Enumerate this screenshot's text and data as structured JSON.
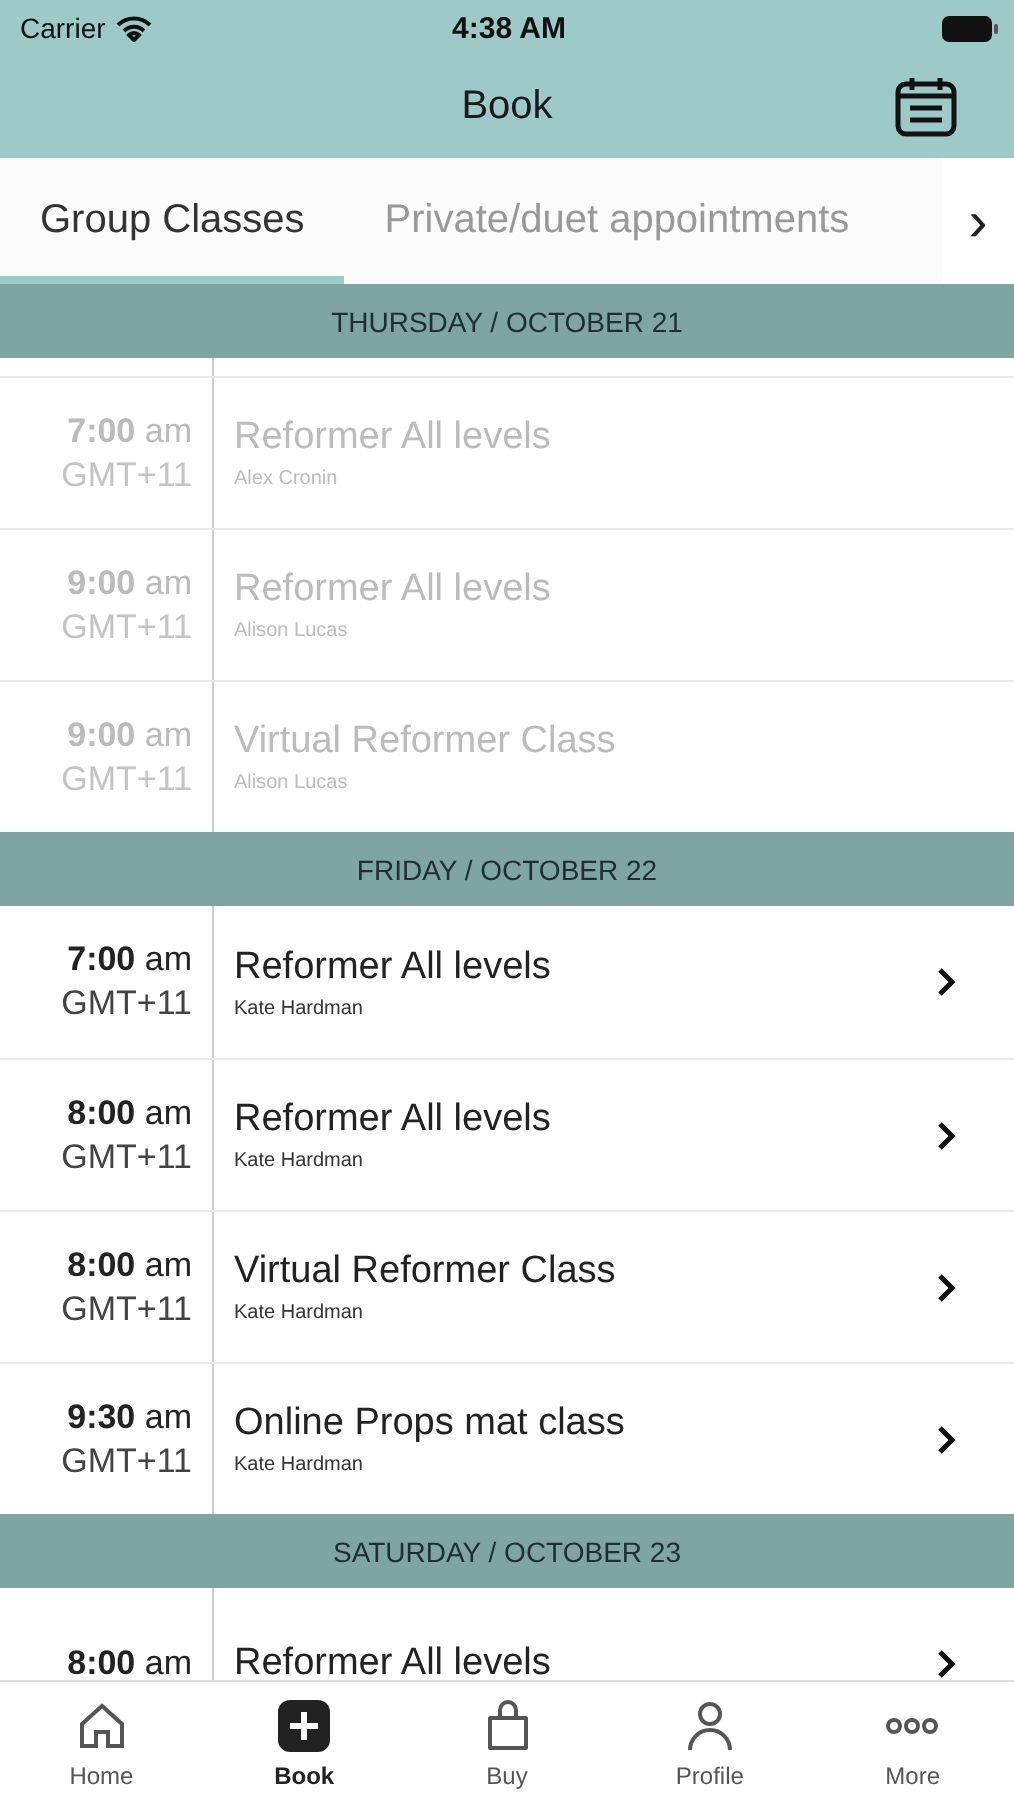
{
  "status_bar": {
    "carrier": "Carrier",
    "time": "4:38 AM"
  },
  "nav": {
    "title": "Book"
  },
  "tabs": [
    {
      "label": "Group Classes",
      "selected": true
    },
    {
      "label": "Private/duet appointments",
      "selected": false
    }
  ],
  "tabs_more": "›",
  "days": [
    {
      "header": "THURSDAY / OCTOBER 21",
      "classes": [
        {
          "time": "7:00",
          "ampm": "am",
          "tz": "GMT+11",
          "title": "Reformer All levels",
          "instructor": "Alex Cronin",
          "available": false
        },
        {
          "time": "9:00",
          "ampm": "am",
          "tz": "GMT+11",
          "title": "Reformer All levels",
          "instructor": "Alison Lucas",
          "available": false
        },
        {
          "time": "9:00",
          "ampm": "am",
          "tz": "GMT+11",
          "title": "Virtual Reformer Class",
          "instructor": "Alison Lucas",
          "available": false
        }
      ]
    },
    {
      "header": "FRIDAY / OCTOBER 22",
      "classes": [
        {
          "time": "7:00",
          "ampm": "am",
          "tz": "GMT+11",
          "title": "Reformer All levels",
          "instructor": "Kate Hardman",
          "available": true
        },
        {
          "time": "8:00",
          "ampm": "am",
          "tz": "GMT+11",
          "title": "Reformer All levels",
          "instructor": "Kate Hardman",
          "available": true
        },
        {
          "time": "8:00",
          "ampm": "am",
          "tz": "GMT+11",
          "title": "Virtual Reformer Class",
          "instructor": "Kate Hardman",
          "available": true
        },
        {
          "time": "9:30",
          "ampm": "am",
          "tz": "GMT+11",
          "title": "Online Props mat class",
          "instructor": "Kate Hardman",
          "available": true
        }
      ]
    },
    {
      "header": "SATURDAY / OCTOBER 23",
      "classes": [
        {
          "time": "8:00",
          "ampm": "am",
          "title": "Reformer All levels",
          "available": true
        }
      ]
    }
  ],
  "tab_bar": [
    {
      "label": "Home",
      "kind": "home",
      "selected": false
    },
    {
      "label": "Book",
      "kind": "book",
      "selected": true
    },
    {
      "label": "Buy",
      "kind": "buy",
      "selected": false
    },
    {
      "label": "Profile",
      "kind": "profile",
      "selected": false
    },
    {
      "label": "More",
      "kind": "more",
      "selected": false
    }
  ]
}
